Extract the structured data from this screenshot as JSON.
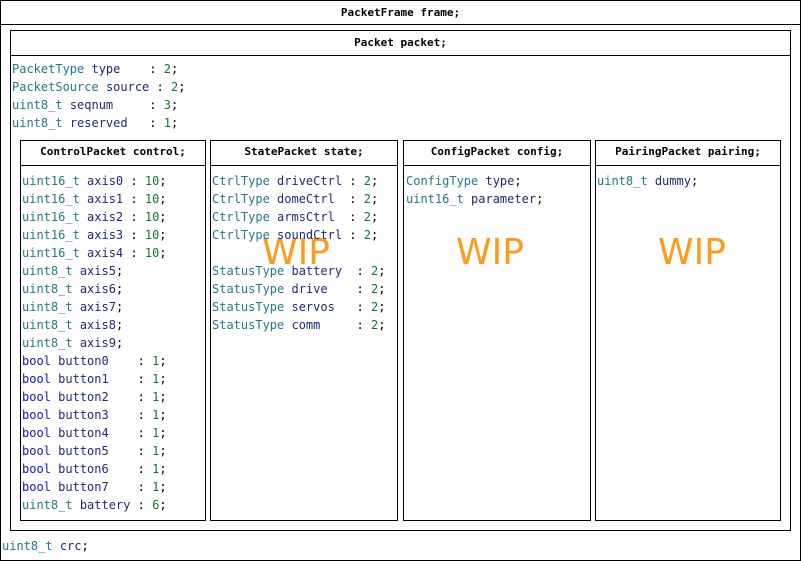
{
  "colors": {
    "type": "#1f7a8c",
    "ident": "#1f2a7a",
    "keyword": "#1414c8",
    "value": "#0a7a2a",
    "wip": "#ff9b1a"
  },
  "frame_title": "PacketFrame frame;",
  "packet_title": "Packet packet;",
  "packet_fields": [
    {
      "type": "PacketType",
      "name": "type",
      "pad": "    ",
      "value": "2"
    },
    {
      "type": "PacketSource",
      "name": "source",
      "pad": " ",
      "value": "2"
    },
    {
      "type": "uint8_t",
      "name": "seqnum",
      "pad": "     ",
      "value": "3"
    },
    {
      "type": "uint8_t",
      "name": "reserved",
      "pad": "   ",
      "value": "1"
    }
  ],
  "control": {
    "title": "ControlPacket control;",
    "fields": [
      {
        "type": "uint16_t",
        "name": "axis0",
        "sep": " : ",
        "value": "10",
        "kw": false
      },
      {
        "type": "uint16_t",
        "name": "axis1",
        "sep": " : ",
        "value": "10",
        "kw": false
      },
      {
        "type": "uint16_t",
        "name": "axis2",
        "sep": " : ",
        "value": "10",
        "kw": false
      },
      {
        "type": "uint16_t",
        "name": "axis3",
        "sep": " : ",
        "value": "10",
        "kw": false
      },
      {
        "type": "uint16_t",
        "name": "axis4",
        "sep": " : ",
        "value": "10",
        "kw": false
      },
      {
        "type": "uint8_t",
        "name": "axis5",
        "sep": "",
        "value": "",
        "kw": false
      },
      {
        "type": "uint8_t",
        "name": "axis6",
        "sep": "",
        "value": "",
        "kw": false
      },
      {
        "type": "uint8_t",
        "name": "axis7",
        "sep": "",
        "value": "",
        "kw": false
      },
      {
        "type": "uint8_t",
        "name": "axis8",
        "sep": "",
        "value": "",
        "kw": false
      },
      {
        "type": "uint8_t",
        "name": "axis9",
        "sep": "",
        "value": "",
        "kw": false
      },
      {
        "type": "bool",
        "name": "button0",
        "sep": "    : ",
        "value": "1",
        "kw": true
      },
      {
        "type": "bool",
        "name": "button1",
        "sep": "    : ",
        "value": "1",
        "kw": true
      },
      {
        "type": "bool",
        "name": "button2",
        "sep": "    : ",
        "value": "1",
        "kw": true
      },
      {
        "type": "bool",
        "name": "button3",
        "sep": "    : ",
        "value": "1",
        "kw": true
      },
      {
        "type": "bool",
        "name": "button4",
        "sep": "    : ",
        "value": "1",
        "kw": true
      },
      {
        "type": "bool",
        "name": "button5",
        "sep": "    : ",
        "value": "1",
        "kw": true
      },
      {
        "type": "bool",
        "name": "button6",
        "sep": "    : ",
        "value": "1",
        "kw": true
      },
      {
        "type": "bool",
        "name": "button7",
        "sep": "    : ",
        "value": "1",
        "kw": true
      },
      {
        "type": "uint8_t",
        "name": "battery",
        "sep": " : ",
        "value": "6",
        "kw": false
      }
    ]
  },
  "state": {
    "title": "StatePacket state;",
    "ctrl_fields": [
      {
        "type": "CtrlType",
        "name": "driveCtrl",
        "sep": " : ",
        "value": "2"
      },
      {
        "type": "CtrlType",
        "name": "domeCtrl",
        "sep": "  : ",
        "value": "2"
      },
      {
        "type": "CtrlType",
        "name": "armsCtrl",
        "sep": "  : ",
        "value": "2"
      },
      {
        "type": "CtrlType",
        "name": "soundCtrl",
        "sep": " : ",
        "value": "2"
      }
    ],
    "status_fields": [
      {
        "type": "StatusType",
        "name": "battery",
        "sep": "  : ",
        "value": "2"
      },
      {
        "type": "StatusType",
        "name": "drive",
        "sep": "    : ",
        "value": "2"
      },
      {
        "type": "StatusType",
        "name": "servos",
        "sep": "   : ",
        "value": "2"
      },
      {
        "type": "StatusType",
        "name": "comm",
        "sep": "     : ",
        "value": "2"
      }
    ],
    "wip": "WIP"
  },
  "config": {
    "title": "ConfigPacket config;",
    "fields": [
      {
        "type": "ConfigType",
        "name": "type"
      },
      {
        "type": "uint16_t",
        "name": "parameter"
      }
    ],
    "wip": "WIP"
  },
  "pairing": {
    "title": "PairingPacket pairing;",
    "fields": [
      {
        "type": "uint8_t",
        "name": "dummy"
      }
    ],
    "wip": "WIP"
  },
  "crc_field": {
    "type": "uint8_t",
    "name": "crc"
  }
}
